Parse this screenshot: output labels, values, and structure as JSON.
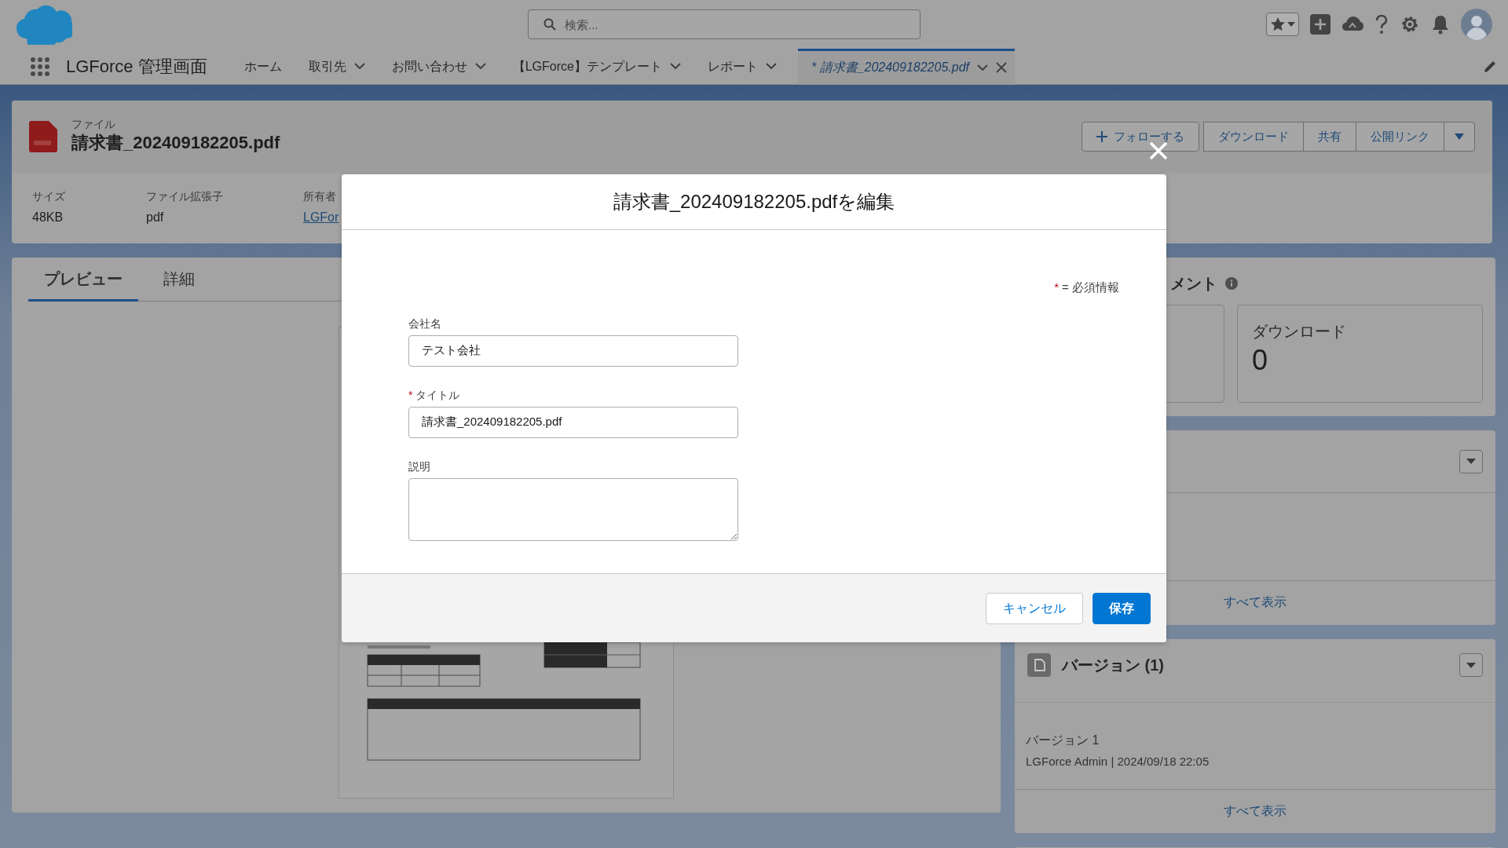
{
  "global_header": {
    "search": {
      "placeholder": "検索..."
    }
  },
  "app_nav": {
    "app_name": "LGForce 管理画面",
    "items": [
      {
        "label": "ホーム",
        "has_menu": false,
        "selected": false
      },
      {
        "label": "取引先",
        "has_menu": true,
        "selected": false
      },
      {
        "label": "お問い合わせ",
        "has_menu": true,
        "selected": false
      },
      {
        "label": "【LGForce】テンプレート",
        "has_menu": true,
        "selected": false
      },
      {
        "label": "レポート",
        "has_menu": true,
        "selected": false
      },
      {
        "label": "* 請求書_202409182205.pdf",
        "has_menu": true,
        "selected": true,
        "closable": true
      }
    ]
  },
  "record": {
    "type_label": "ファイル",
    "title": "請求書_202409182205.pdf",
    "actions": [
      {
        "label": "フォローする",
        "kind": "follow"
      },
      {
        "label": "ダウンロード",
        "kind": "plain"
      },
      {
        "label": "共有",
        "kind": "plain"
      },
      {
        "label": "公開リンク",
        "kind": "plain"
      }
    ],
    "fields": [
      {
        "label": "サイズ",
        "value": "48KB",
        "kind": "text"
      },
      {
        "label": "ファイル拡張子",
        "value": "pdf",
        "kind": "text"
      },
      {
        "label": "所有者",
        "value": "LGFor",
        "kind": "link"
      }
    ]
  },
  "tabs": [
    {
      "label": "プレビュー",
      "selected": true
    },
    {
      "label": "詳細",
      "selected": false
    }
  ],
  "engagement": {
    "title": "メント",
    "tiles": [
      {
        "label": "ダウンロード",
        "value": "0"
      }
    ]
  },
  "related": {
    "view_all": "すべて表示"
  },
  "versions": {
    "title": "バージョン (1)",
    "items": [
      {
        "name": "バージョン 1",
        "meta": "LGForce Admin | 2024/09/18 22:05"
      }
    ],
    "view_all": "すべて表示"
  },
  "modal": {
    "title": "請求書_202409182205.pdfを編集",
    "legend": {
      "mark": "*",
      "text": "= 必須情報"
    },
    "fields": [
      {
        "label": "会社名",
        "value": "テスト会社",
        "kind": "input"
      },
      {
        "label": "タイトル",
        "required_mark": "*",
        "value": "請求書_202409182205.pdf",
        "kind": "input"
      },
      {
        "label": "説明",
        "kind": "textarea"
      }
    ],
    "buttons": [
      {
        "label": "キャンセル",
        "primary": false
      },
      {
        "label": "保存",
        "primary": true
      }
    ]
  }
}
